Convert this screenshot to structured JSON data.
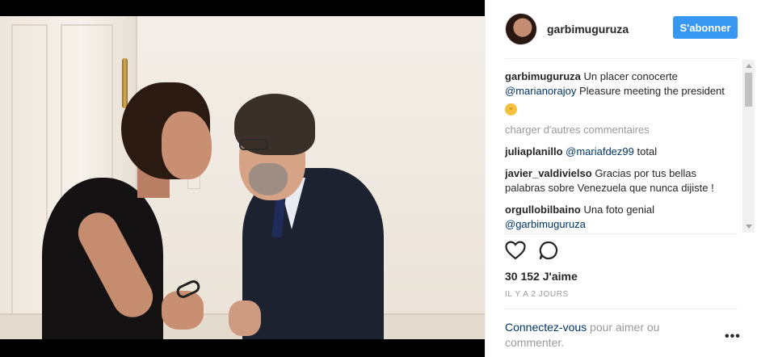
{
  "post": {
    "image_alt": "",
    "username": "garbimuguruza",
    "follow_label": "S'abonner"
  },
  "caption": {
    "user": "garbimuguruza",
    "text_before": "Un placer conocerte ",
    "mention": "@marianorajoy",
    "text_after": " Pleasure meeting the president",
    "emoji": "😄"
  },
  "load_more_label": "charger d'autres commentaires",
  "comments": [
    {
      "user": "juliaplanillo",
      "mention": "@mariafdez99",
      "text": "total"
    },
    {
      "user": "javier_valdivielso",
      "mention": "",
      "text": "Gracias por tus bellas palabras sobre Venezuela que nunca dijiste !"
    },
    {
      "user": "orgullobilbaino",
      "mention": "@garbimuguruza",
      "text": "Una foto genial"
    }
  ],
  "likes": "30 152 J'aime",
  "timestamp": "IL Y A 2 JOURS",
  "login_prompt": {
    "link": "Connectez-vous",
    "text": " pour aimer ou commenter."
  },
  "more_label": "•••",
  "icons": {
    "like": "heart-icon",
    "comment": "speech-bubble-icon",
    "more": "more-options-icon"
  },
  "colors": {
    "follow_button": "#3897f0",
    "link": "#003569",
    "muted": "#999999"
  }
}
